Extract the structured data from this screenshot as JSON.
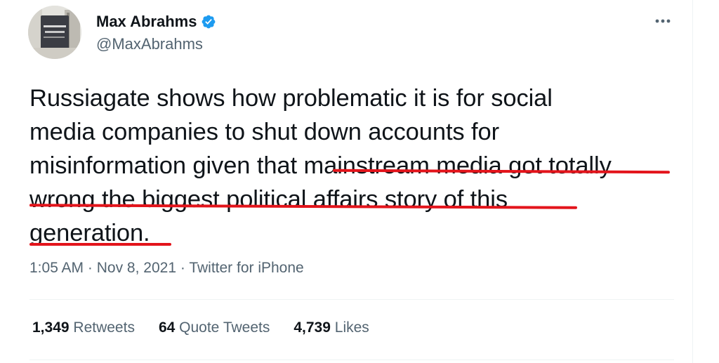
{
  "author": {
    "name": "Max Abrahms",
    "handle": "@MaxAbrahms",
    "verified": true
  },
  "tweet": {
    "lines": [
      "Russiagate shows how problematic it is for social",
      "media companies to shut down accounts for",
      "misinformation given that mainstream media got totally",
      "wrong the biggest political affairs story of this",
      "generation."
    ],
    "highlighted_text": "mainstream media got totally wrong the biggest political affairs story of this generation.",
    "highlight_color": "#e3141b"
  },
  "meta": {
    "time": "1:05 AM",
    "separator1": "·",
    "date": "Nov 8, 2021",
    "separator2": "·",
    "source": "Twitter for iPhone"
  },
  "stats": {
    "retweets": {
      "count": "1,349",
      "label": "Retweets"
    },
    "quotes": {
      "count": "64",
      "label": "Quote Tweets"
    },
    "likes": {
      "count": "4,739",
      "label": "Likes"
    }
  },
  "icons": {
    "verified": "verified-badge-icon",
    "more": "more-options-icon"
  },
  "colors": {
    "text": "#0f1419",
    "secondary": "#536471",
    "verified": "#1d9bf0",
    "underline": "#e3141b",
    "divider": "#eff3f4"
  }
}
